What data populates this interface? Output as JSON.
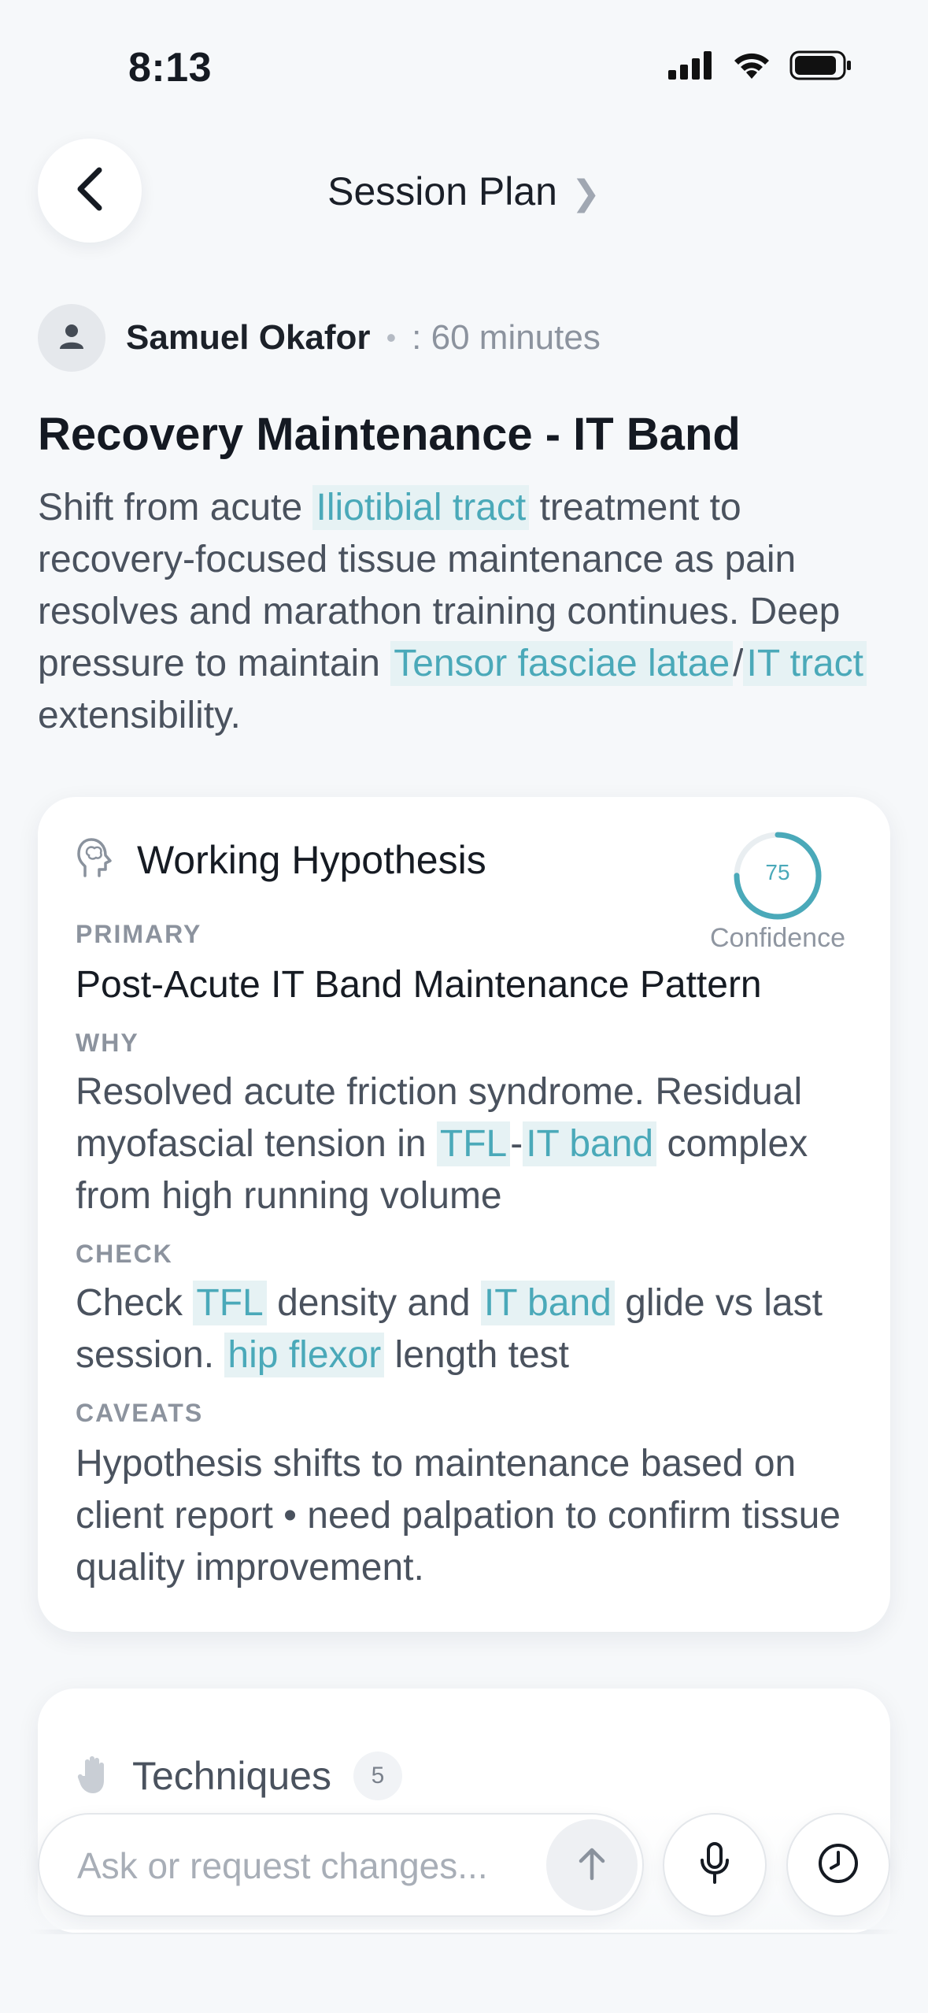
{
  "status_bar": {
    "time": "8:13",
    "icons": [
      "cellular-signal-icon",
      "wifi-icon",
      "battery-icon"
    ]
  },
  "nav": {
    "title": "Session Plan",
    "title_chevron": "❯",
    "back_icon": "chevron-left-icon"
  },
  "client": {
    "name": "Samuel Okafor",
    "separator": "•",
    "duration": ": 60 minutes"
  },
  "plan": {
    "title": "Recovery Maintenance - IT Band",
    "description": {
      "t1": "Shift from acute ",
      "h1": "Iliotibial tract",
      "t2": " treatment to recovery-focused tissue maintenance as pain resolves and marathon training continues. Deep pressure to maintain ",
      "h2": "Tensor fasciae latae",
      "t3": "/",
      "h3": "IT tract",
      "t4": " extensibility."
    }
  },
  "hypothesis": {
    "title": "Working Hypothesis",
    "icon": "brain-head-icon",
    "confidence": {
      "value": 75,
      "value_label": "75",
      "label": "Confidence"
    },
    "primary_label": "PRIMARY",
    "primary": "Post-Acute IT Band Maintenance Pattern",
    "why_label": "WHY",
    "why": {
      "t1": "Resolved acute friction syndrome. Residual myofascial tension in ",
      "h1": "TFL",
      "t2": "-",
      "h2": "IT band",
      "t3": " complex from high running volume"
    },
    "check_label": "CHECK",
    "check": {
      "t1": "Check ",
      "h1": "TFL",
      "t2": " density and ",
      "h2": "IT band",
      "t3": " glide vs last session. ",
      "h3": "hip flexor",
      "t4": " length test"
    },
    "caveats_label": "CAVEATS",
    "caveats": "Hypothesis shifts to maintenance based on client report • need palpation to confirm tissue quality improvement."
  },
  "techniques": {
    "title": "Techniques",
    "count": "5",
    "icon": "hand-icon"
  },
  "composer": {
    "placeholder": "Ask or request changes...",
    "send_icon": "arrow-up-icon",
    "mic_icon": "microphone-icon",
    "history_icon": "clock-icon"
  },
  "colors": {
    "accent": "#4aa9b9",
    "highlight_bg": "#e6f2f4",
    "background": "#f6f8fa"
  }
}
